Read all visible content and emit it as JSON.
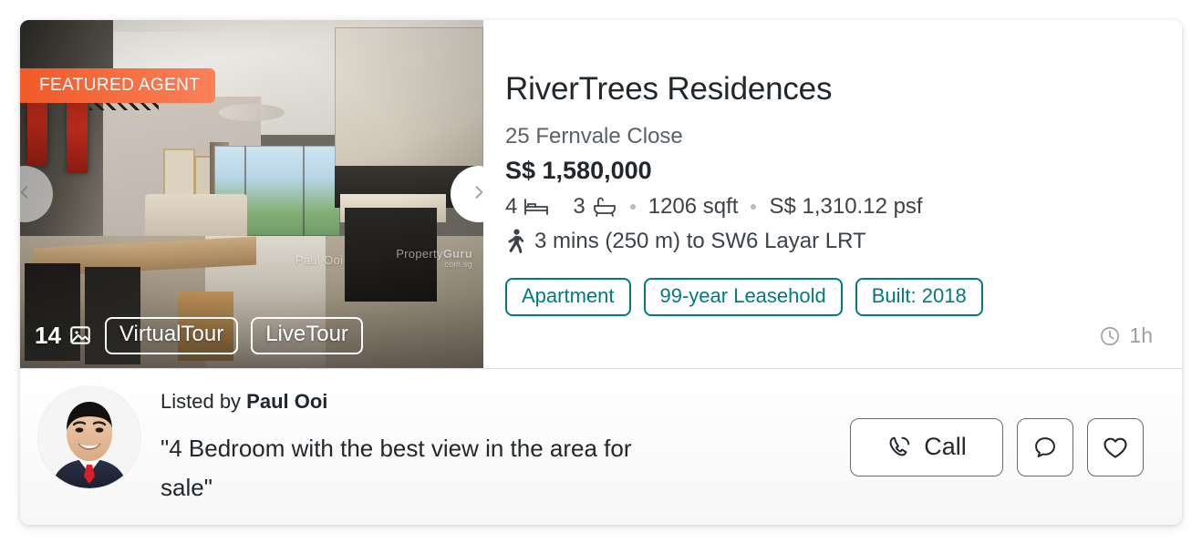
{
  "card": {
    "gallery": {
      "featured_badge": "FEATURED AGENT",
      "photo_count": "14",
      "photo_count_icon": "image-icon",
      "virtual_tour_label": "VirtualTour",
      "live_tour_label": "LiveTour",
      "prev_icon": "chevron-left-icon",
      "next_icon": "chevron-right-icon",
      "watermark_agent": "Paul Ooi",
      "watermark_brand_prefix": "Property",
      "watermark_brand_suffix": "Guru",
      "watermark_brand_domain": ".com.sg"
    },
    "info": {
      "title": "RiverTrees Residences",
      "address": "25 Fernvale Close",
      "price": "S$ 1,580,000",
      "beds": "4",
      "beds_icon": "bed-icon",
      "baths": "3",
      "baths_icon": "bathtub-icon",
      "area": "1206 sqft",
      "psf": "S$ 1,310.12 psf",
      "transit_icon": "walking-person-icon",
      "transit": "3 mins (250 m) to SW6 Layar LRT",
      "tags": [
        "Apartment",
        "99-year Leasehold",
        "Built: 2018"
      ],
      "posted_icon": "clock-icon",
      "posted": "1h"
    },
    "footer": {
      "avatar_name": "agent-avatar",
      "listed_by_prefix": "Listed by ",
      "agent_name": "Paul Ooi",
      "quote": "\"4 Bedroom with the best view in the area for sale\"",
      "call_label": "Call",
      "call_icon": "phone-icon",
      "chat_icon": "chat-bubble-icon",
      "favourite_icon": "heart-icon"
    }
  },
  "colors": {
    "accent_teal": "#007b80",
    "badge_orange_start": "#f05a28",
    "badge_orange_end": "#fb8159",
    "text_primary": "#22272b",
    "text_muted": "#5b6165",
    "text_light": "#9a9fa3"
  }
}
